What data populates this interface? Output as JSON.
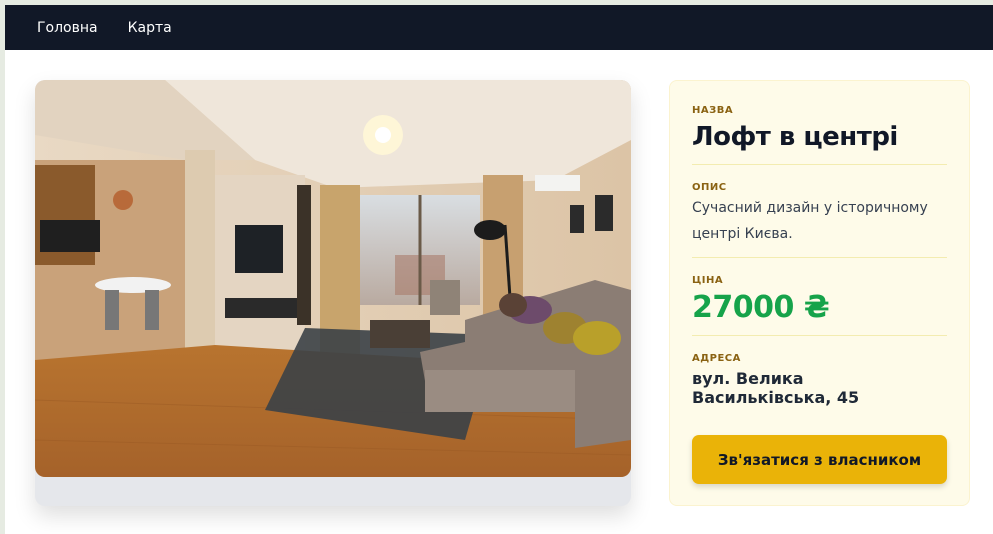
{
  "nav": {
    "items": [
      {
        "label": "Головна"
      },
      {
        "label": "Карта"
      }
    ]
  },
  "listing": {
    "photo_icon": "apartment-living-room-photo",
    "name_label": "Назва",
    "name": "Лофт в центрі",
    "description_label": "Опис",
    "description": "Сучасний дизайн у історичному центрі Києва.",
    "price_label": "Ціна",
    "price": "27000 ₴",
    "address_label": "Адреса",
    "address": "вул. Велика Васильківська, 45",
    "contact_button": "Зв'язатися з власником"
  },
  "colors": {
    "navbar": "#111827",
    "accent": "#eab308",
    "price": "#16a34a",
    "panel": "#fefbe9",
    "label": "#8a6212"
  }
}
